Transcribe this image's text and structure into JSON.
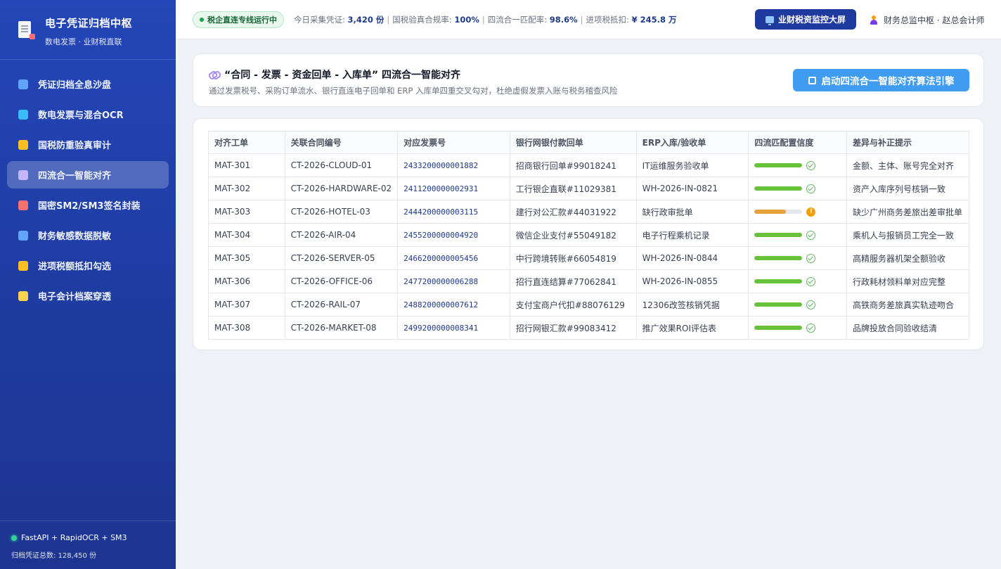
{
  "brand": {
    "title": "电子凭证归档中枢",
    "subtitle": "数电发票 · 业财税直联"
  },
  "sidebar": {
    "items": [
      {
        "label": "凭证归档全息沙盘",
        "icon": "bar-chart-icon",
        "active": false
      },
      {
        "label": "数电发票与混合OCR",
        "icon": "magnifier-icon",
        "active": false
      },
      {
        "label": "国税防重验真审计",
        "icon": "scales-icon",
        "active": false
      },
      {
        "label": "四流合一智能对齐",
        "icon": "link-icon",
        "active": true
      },
      {
        "label": "国密SM2/SM3签名封装",
        "icon": "lock-icon",
        "active": false
      },
      {
        "label": "财务敏感数据脱敏",
        "icon": "shield-icon",
        "active": false
      },
      {
        "label": "进项税额抵扣勾选",
        "icon": "money-bag-icon",
        "active": false
      },
      {
        "label": "电子会计档案穿透",
        "icon": "ledger-icon",
        "active": false
      }
    ],
    "footer": {
      "stack": "FastAPI + RapidOCR + SM3",
      "total": "归档凭证总数: 128,450 份"
    }
  },
  "topbar": {
    "status_pill": "税企直连专线运行中",
    "stats": {
      "collected_label": "今日采集凭证: ",
      "collected_value": "3,420 份",
      "verify_label": "国税验真合规率: ",
      "verify_value": "100%",
      "match_label": "四流合一匹配率: ",
      "match_value": "98.6%",
      "deduct_label": "进项税抵扣: ",
      "deduct_value": "¥ 245.8 万"
    },
    "monitor_button": "业财税资监控大屏",
    "user": "财务总监中枢 · 赵总会计师"
  },
  "header": {
    "title": "“合同 - 发票 - 资金回单 - 入库单” 四流合一智能对齐",
    "description": "通过发票税号、采购订单流水、银行直连电子回单和 ERP 入库单四重交叉勾对，杜绝虚假发票入账与税务稽查风险",
    "engine_button": "启动四流合一智能对齐算法引擎"
  },
  "table": {
    "columns": [
      "对齐工单",
      "关联合同编号",
      "对应发票号",
      "银行网银付款回单",
      "ERP入库/验收单",
      "四流匹配置信度",
      "差异与补正提示"
    ],
    "rows": [
      {
        "id": "MAT-301",
        "contract": "CT-2026-CLOUD-01",
        "invoice": "2433200000001882",
        "bank": "招商银行回单#99018241",
        "erp": "IT运维服务验收单",
        "confidence": 1.0,
        "status": "ok",
        "note": "金额、主体、账号完全对齐"
      },
      {
        "id": "MAT-302",
        "contract": "CT-2026-HARDWARE-02",
        "invoice": "2411200000002931",
        "bank": "工行银企直联#11029381",
        "erp": "WH-2026-IN-0821",
        "confidence": 1.0,
        "status": "ok",
        "note": "资产入库序列号核销一致"
      },
      {
        "id": "MAT-303",
        "contract": "CT-2026-HOTEL-03",
        "invoice": "2444200000003115",
        "bank": "建行对公汇款#44031922",
        "erp": "缺行政审批单",
        "confidence": 0.65,
        "status": "warn",
        "note": "缺少广州商务差旅出差审批单"
      },
      {
        "id": "MAT-304",
        "contract": "CT-2026-AIR-04",
        "invoice": "2455200000004920",
        "bank": "微信企业支付#55049182",
        "erp": "电子行程乘机记录",
        "confidence": 1.0,
        "status": "ok",
        "note": "乘机人与报销员工完全一致"
      },
      {
        "id": "MAT-305",
        "contract": "CT-2026-SERVER-05",
        "invoice": "2466200000005456",
        "bank": "中行跨境转账#66054819",
        "erp": "WH-2026-IN-0844",
        "confidence": 1.0,
        "status": "ok",
        "note": "高精服务器机架全额验收"
      },
      {
        "id": "MAT-306",
        "contract": "CT-2026-OFFICE-06",
        "invoice": "2477200000006288",
        "bank": "招行直连结算#77062841",
        "erp": "WH-2026-IN-0855",
        "confidence": 1.0,
        "status": "ok",
        "note": "行政耗材领料单对应完整"
      },
      {
        "id": "MAT-307",
        "contract": "CT-2026-RAIL-07",
        "invoice": "2488200000007612",
        "bank": "支付宝商户代扣#88076129",
        "erp": "12306改签核销凭据",
        "confidence": 1.0,
        "status": "ok",
        "note": "高铁商务差旅真实轨迹吻合"
      },
      {
        "id": "MAT-308",
        "contract": "CT-2026-MARKET-08",
        "invoice": "2499200000008341",
        "bank": "招行网银汇款#99083412",
        "erp": "推广效果ROI评估表",
        "confidence": 1.0,
        "status": "ok",
        "note": "品牌投放合同验收结清"
      }
    ]
  },
  "colors": {
    "ok": "#67c23a",
    "warn": "#e6a23c",
    "accent": "#409cf0",
    "sidebar": "#2346b8"
  }
}
